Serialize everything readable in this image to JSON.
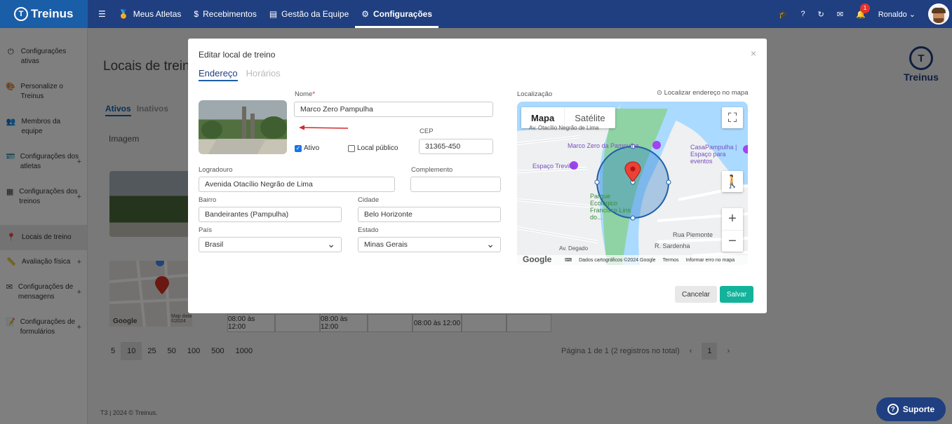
{
  "brand": {
    "name": "Treinus"
  },
  "nav": {
    "items": [
      {
        "label": "Meus Atletas",
        "icon": "medal-icon"
      },
      {
        "label": "Recebimentos",
        "icon": "dollar-icon"
      },
      {
        "label": "Gestão da Equipe",
        "icon": "newspaper-icon"
      },
      {
        "label": "Configurações",
        "icon": "gears-icon",
        "active": true
      }
    ],
    "notifications_count": "1",
    "user_name": "Ronaldo"
  },
  "sidebar": {
    "items": [
      {
        "label": "Configurações ativas"
      },
      {
        "label": "Personalize o Treinus"
      },
      {
        "label": "Membros da equipe"
      },
      {
        "label": "Configurações dos atletas",
        "expandable": "+"
      },
      {
        "label": "Configurações dos treinos",
        "expandable": "+"
      },
      {
        "label": "Locais de treino",
        "active": true
      },
      {
        "label": "Avaliação física",
        "expandable": "+"
      },
      {
        "label": "Configurações de mensagens",
        "expandable": "+"
      },
      {
        "label": "Configurações de formulários",
        "expandable": "+"
      }
    ]
  },
  "page": {
    "title": "Locais de treino",
    "tabs": [
      "Ativos",
      "Inativos"
    ],
    "column_image": "Imagem",
    "thumb_map_credit": "Map data ©2024",
    "thumb_map_google": "Google",
    "time_slots": [
      "08:00 às 12:00",
      "08:00 às 12:00",
      "08:00 às 12:00"
    ],
    "page_sizes": [
      "5",
      "10",
      "25",
      "50",
      "100",
      "500",
      "1000"
    ],
    "page_size_selected": "10",
    "pagination_text": "Página 1 de 1 (2 registros no total)",
    "current_page": "1",
    "footer": "T3 | 2024 © Treinus.",
    "right_logo": "Treinus"
  },
  "support": {
    "label": "Suporte"
  },
  "modal": {
    "title": "Editar local de treino",
    "close": "×",
    "tabs": {
      "address": "Endereço",
      "hours": "Horários"
    },
    "fields": {
      "name": {
        "label": "Nome",
        "required_mark": "*",
        "value": "Marco Zero Pampulha"
      },
      "cep": {
        "label": "CEP",
        "value": "31365-450"
      },
      "active": {
        "label": "Ativo",
        "checked": true
      },
      "public": {
        "label": "Local público",
        "checked": false
      },
      "street": {
        "label": "Logradouro",
        "value": "Avenida Otacílio Negrão de Lima"
      },
      "complement": {
        "label": "Complemento",
        "value": ""
      },
      "neighborhood": {
        "label": "Bairro",
        "value": "Bandeirantes (Pampulha)"
      },
      "city": {
        "label": "Cidade",
        "value": "Belo Horizonte"
      },
      "country": {
        "label": "País",
        "value": "Brasil"
      },
      "state": {
        "label": "Estado",
        "value": "Minas Gerais"
      }
    },
    "map": {
      "label": "Localização",
      "locate_button": "Localizar endereço no mapa",
      "type_buttons": {
        "map": "Mapa",
        "satellite": "Satélite"
      },
      "places": {
        "marco_zero": "Marco Zero da Pampulha",
        "casa_pampulha": "CasaPampulha | Espaço para eventos",
        "espaco_treville": "Espaço Treville",
        "parque": "Parque Ecológico Francisco Lins do...",
        "rua_piemonte": "Rua Piemonte",
        "r_sardenha": "R. Sardenha",
        "av_otacilio": "Av. Otacílio Negrão de Lima",
        "av_degado": "Av. Degado"
      },
      "attribution": {
        "google": "Google",
        "keyboard": "⌨",
        "data": "Dados cartográficos ©2024 Google",
        "terms": "Termos",
        "report": "Informar erro no mapa"
      }
    },
    "buttons": {
      "cancel": "Cancelar",
      "save": "Salvar"
    }
  }
}
